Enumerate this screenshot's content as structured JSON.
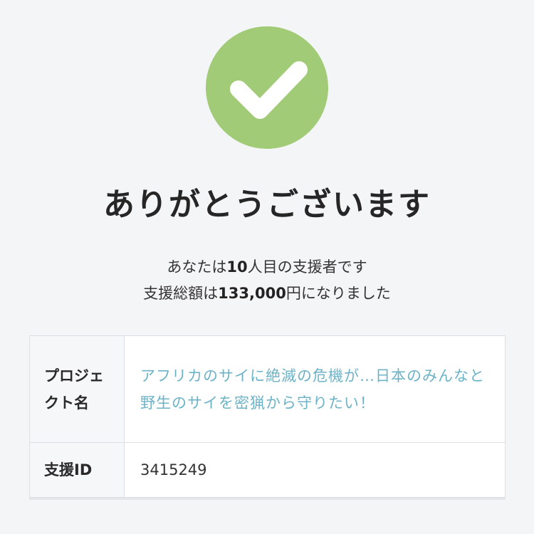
{
  "success_icon": {
    "icon": "checkmark-icon",
    "color": "#a1cb77"
  },
  "title": "ありがとうございます",
  "message": {
    "line1_prefix": "あなたは",
    "supporter_count": "10",
    "line1_suffix": "人目の支援者です",
    "line2_prefix": "支援総額は",
    "total_amount": "133,000",
    "line2_suffix": "円になりました"
  },
  "details": {
    "project_label": "プロジェクト名",
    "project_name": "アフリカのサイに絶滅の危機が…日本のみんなと野生のサイを密猟から守りたい！",
    "support_id_label": "支援ID",
    "support_id": "3415249"
  },
  "colors": {
    "link": "#6db3c7",
    "background": "#f4f5f7"
  }
}
